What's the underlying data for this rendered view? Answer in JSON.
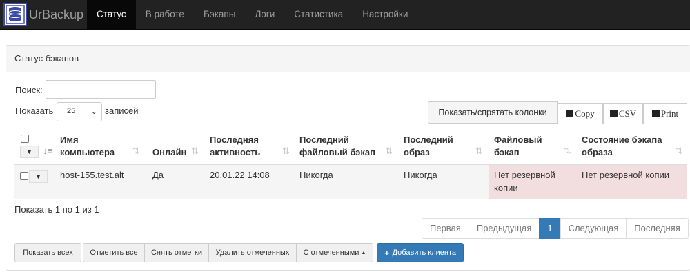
{
  "brand": {
    "name": "UrBackup"
  },
  "nav": [
    {
      "label": "Статус",
      "active": true
    },
    {
      "label": "В работе",
      "active": false
    },
    {
      "label": "Бэкапы",
      "active": false
    },
    {
      "label": "Логи",
      "active": false
    },
    {
      "label": "Статистика",
      "active": false
    },
    {
      "label": "Настройки",
      "active": false
    }
  ],
  "panel": {
    "title": "Статус бэкапов"
  },
  "search": {
    "label": "Поиск:",
    "value": ""
  },
  "length": {
    "prefix": "Показать",
    "value": "25",
    "suffix": "записей"
  },
  "toolbar": {
    "colvis": "Показать/спрятать колонки",
    "copy": "Copy",
    "csv": "CSV",
    "print": "Print"
  },
  "table": {
    "headers": [
      {
        "l1": "Имя",
        "l2": "компьютера"
      },
      {
        "l1": "Онлайн",
        "l2": ""
      },
      {
        "l1": "Последняя",
        "l2": "активность"
      },
      {
        "l1": "Последний",
        "l2": "файловый бэкап"
      },
      {
        "l1": "Последний",
        "l2": "образ"
      },
      {
        "l1": "Файловый",
        "l2": "бэкап"
      },
      {
        "l1": "Состояние бэкапа",
        "l2": "образа"
      }
    ],
    "rows": [
      {
        "name": "host-155.test.alt",
        "online": "Да",
        "last_seen": "20.01.22 14:08",
        "last_file_backup": "Никогда",
        "last_image": "Никогда",
        "file_status_l1": "Нет резервной",
        "file_status_l2": "копии",
        "image_status": "Нет резервной копии"
      }
    ]
  },
  "info": "Показать 1 по 1 из 1",
  "pagination": {
    "first": "Первая",
    "prev": "Предыдущая",
    "current": "1",
    "next": "Следующая",
    "last": "Последняя"
  },
  "actions": {
    "show_all": "Показать всех",
    "select_all": "Отметить все",
    "deselect": "Снять отметки",
    "delete_selected": "Удалить отмеченных",
    "with_selected": "С отмеченными",
    "add_client": "Добавить клиента"
  },
  "colors": {
    "navbar": "#222222",
    "danger_row": "#f2dede",
    "primary": "#337ab7"
  }
}
